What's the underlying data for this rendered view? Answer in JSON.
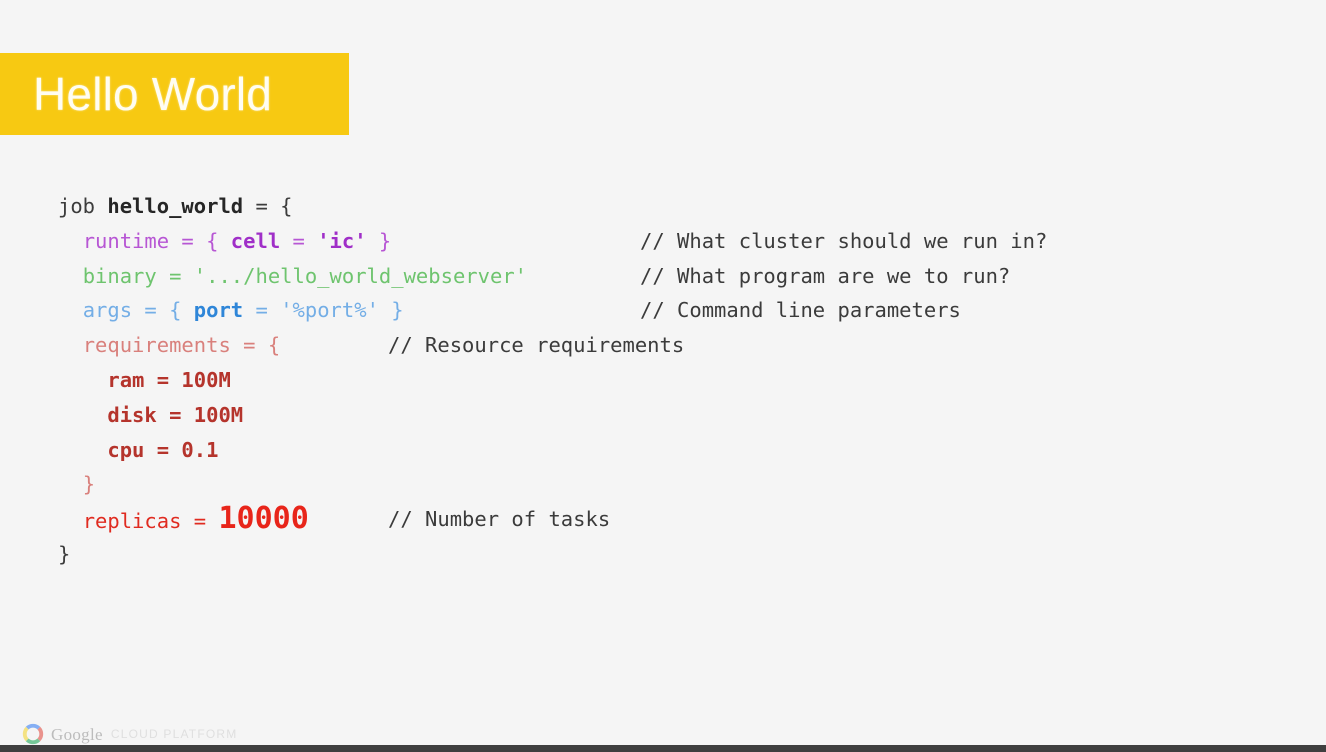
{
  "slide": {
    "title": "Hello World",
    "background_color": "#f5f5f5",
    "banner_color": "#f7c912",
    "title_color": "#fffdf2"
  },
  "code": {
    "language": "borg-config",
    "lines": [
      {
        "indent": 0,
        "tokens": [
          {
            "text": "job ",
            "style": "plain"
          },
          {
            "text": "hello_world",
            "style": "bold"
          },
          {
            "text": " = {",
            "style": "plain"
          }
        ],
        "comment": ""
      },
      {
        "indent": 1,
        "tokens": [
          {
            "text": "runtime = { ",
            "style": "purple"
          },
          {
            "text": "cell",
            "style": "purple-bold"
          },
          {
            "text": " = ",
            "style": "purple"
          },
          {
            "text": "'ic'",
            "style": "purple-bold"
          },
          {
            "text": " }",
            "style": "purple"
          }
        ],
        "comment": "// What cluster should we run in?"
      },
      {
        "indent": 1,
        "tokens": [
          {
            "text": "binary = '.../hello_world_webserver'",
            "style": "green"
          }
        ],
        "comment": "// What program are we to run?"
      },
      {
        "indent": 1,
        "tokens": [
          {
            "text": "args = { ",
            "style": "blue"
          },
          {
            "text": "port",
            "style": "blue-bold"
          },
          {
            "text": " = ",
            "style": "blue"
          },
          {
            "text": "'%port%'",
            "style": "blue"
          },
          {
            "text": " }",
            "style": "blue"
          }
        ],
        "comment": "// Command line parameters"
      },
      {
        "indent": 1,
        "tokens": [
          {
            "text": "requirements = {",
            "style": "salmon"
          }
        ],
        "comment": "// Resource requirements"
      },
      {
        "indent": 2,
        "tokens": [
          {
            "text": "ram = 100M",
            "style": "red-bold"
          }
        ],
        "comment": ""
      },
      {
        "indent": 2,
        "tokens": [
          {
            "text": "disk = 100M",
            "style": "red-bold"
          }
        ],
        "comment": ""
      },
      {
        "indent": 2,
        "tokens": [
          {
            "text": "cpu = 0.1",
            "style": "red-bold"
          }
        ],
        "comment": ""
      },
      {
        "indent": 1,
        "tokens": [
          {
            "text": "}",
            "style": "salmon"
          }
        ],
        "comment": ""
      },
      {
        "indent": 1,
        "tokens": [
          {
            "text": "replicas = ",
            "style": "red"
          },
          {
            "text": "10000",
            "style": "red-big"
          }
        ],
        "comment": "// Number of tasks"
      },
      {
        "indent": 0,
        "tokens": [
          {
            "text": "}",
            "style": "plain"
          }
        ],
        "comment": ""
      }
    ]
  },
  "footer": {
    "logo_icon": "google-ring-icon",
    "wordmark": "Google",
    "subtext": "CLOUD PLATFORM",
    "color_bar": [
      "#4285f4",
      "#e2574c",
      "#f4d73c",
      "#27ae60"
    ]
  }
}
